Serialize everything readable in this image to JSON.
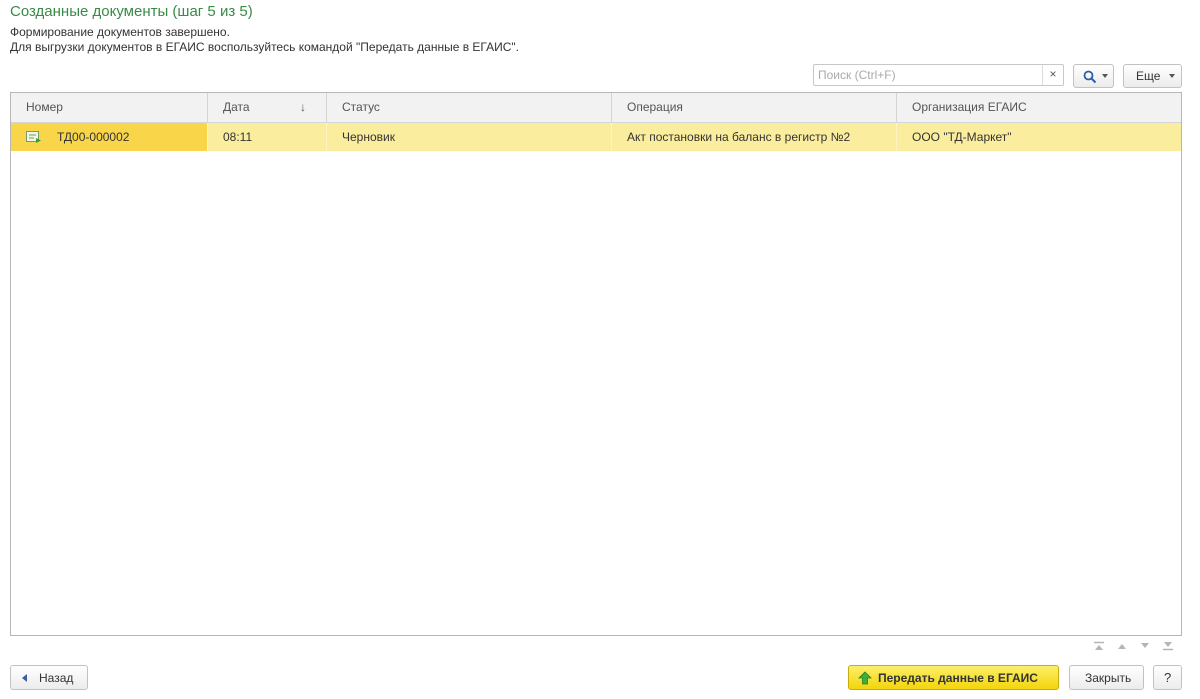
{
  "header": {
    "title": "Созданные документы (шаг 5 из 5)",
    "message_line1": "Формирование документов завершено.",
    "message_line2": "Для выгрузки документов в ЕГАИС воспользуйтесь командой \"Передать данные в ЕГАИС\"."
  },
  "toolbar": {
    "search_placeholder": "Поиск (Ctrl+F)",
    "search_value": "",
    "clear_label": "×",
    "more_label": "Еще"
  },
  "table": {
    "columns": [
      "Номер",
      "Дата",
      "Статус",
      "Операция",
      "Организация ЕГАИС"
    ],
    "sort_indicator": "↓",
    "rows": [
      {
        "number": "ТД00-000002",
        "date": "08:11",
        "status": "Черновик",
        "operation": "Акт постановки на баланс в регистр №2",
        "organization": "ООО \"ТД-Маркет\""
      }
    ]
  },
  "footer": {
    "back_label": "Назад",
    "send_label": "Передать данные в ЕГАИС",
    "close_label": "Закрыть",
    "help_label": "?"
  },
  "colors": {
    "title": "#3a8a48",
    "row_highlight": "#fbed9e",
    "cell_selected": "#f9d54a",
    "primary_button": "#f3d50b"
  }
}
